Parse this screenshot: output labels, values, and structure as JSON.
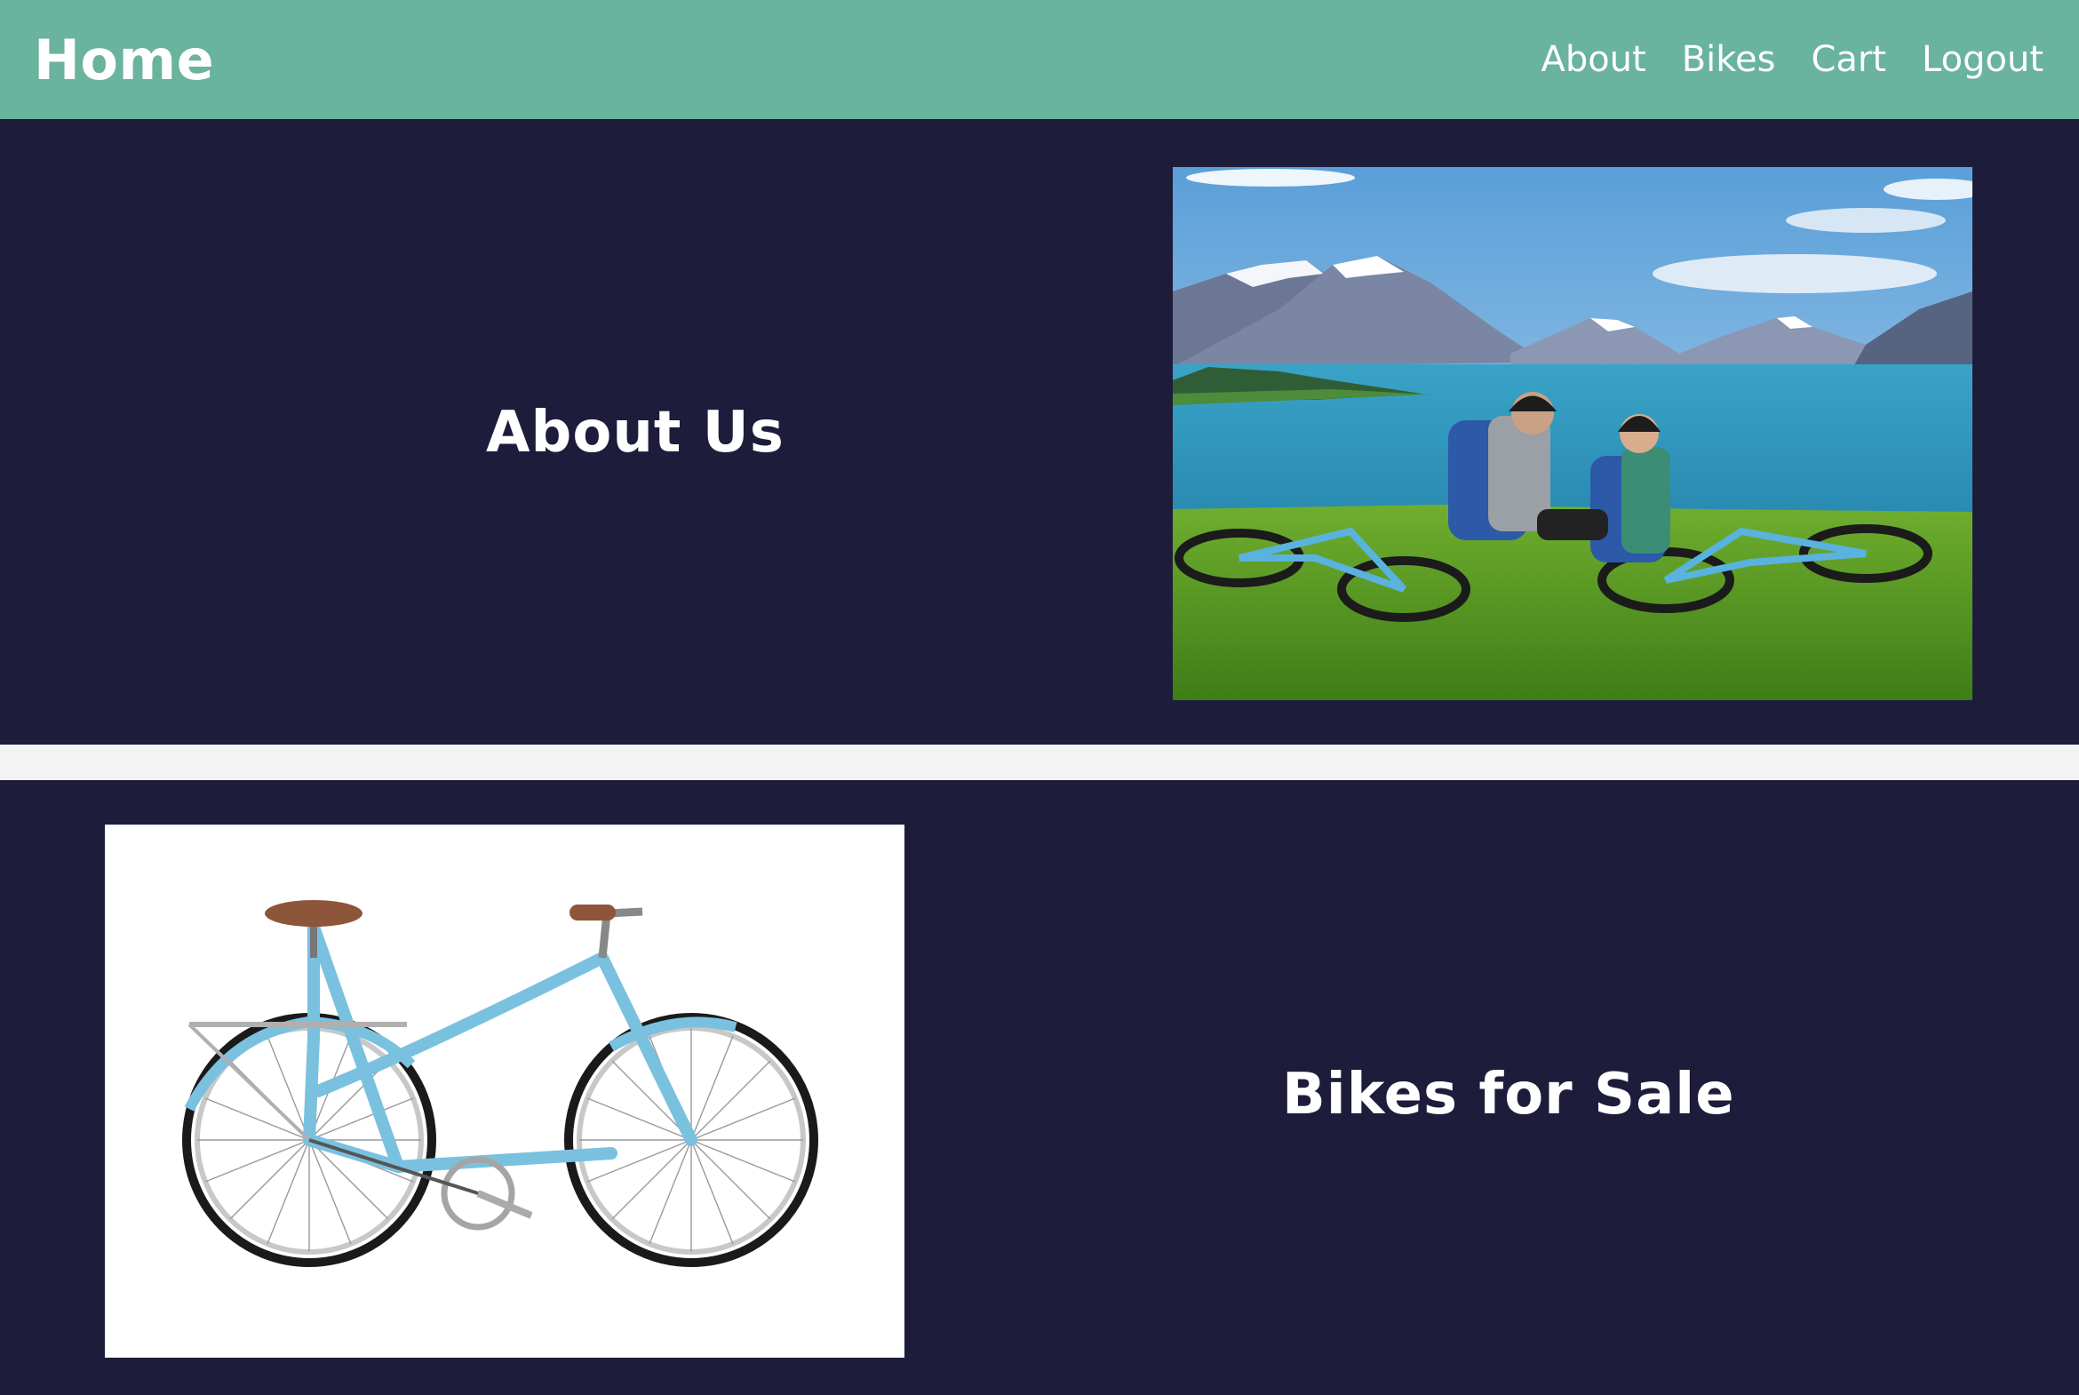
{
  "navbar": {
    "brand": "Home",
    "links": [
      "About",
      "Bikes",
      "Cart",
      "Logout"
    ],
    "color": "#6ab39e"
  },
  "sections": {
    "about": {
      "title": "About Us",
      "image": "cyclists-resting-by-lake-photo"
    },
    "bikes": {
      "title": "Bikes for Sale",
      "image": "light-blue-city-bike-photo"
    },
    "background": "#1e1c3b"
  }
}
